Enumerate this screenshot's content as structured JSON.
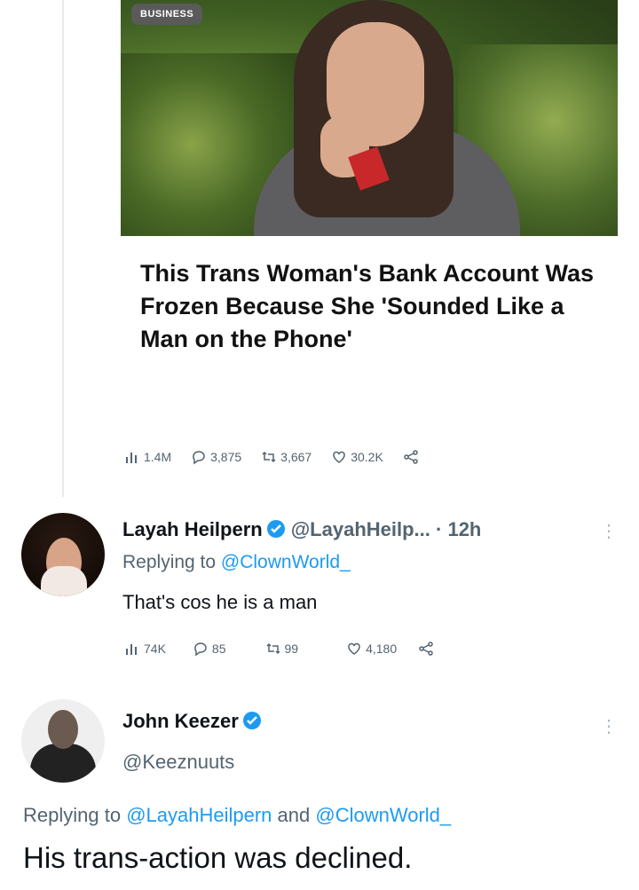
{
  "article": {
    "badge": "BUSINESS",
    "headline": "This Trans Woman's Bank Account Was Frozen Because She 'Sounded Like a Man on the Phone'",
    "metrics": {
      "views": "1.4M",
      "replies": "3,875",
      "retweets": "3,667",
      "likes": "30.2K"
    }
  },
  "reply1": {
    "name": "Layah Heilpern",
    "handle": "@LayahHeilp...",
    "time": "· 12h",
    "replying_prefix": "Replying to",
    "replying_to": "@ClownWorld_",
    "text": "That's cos he is a man",
    "metrics": {
      "views": "74K",
      "replies": "85",
      "retweets": "99",
      "likes": "4,180"
    }
  },
  "reply2": {
    "name": "John Keezer",
    "handle": "@Keeznuuts",
    "replying_prefix": "Replying to",
    "replying_to_1": "@LayahHeilpern",
    "replying_and": "and",
    "replying_to_2": "@ClownWorld_",
    "text": "His trans-action was declined."
  },
  "icons": {
    "views": "bar-chart-icon",
    "reply": "speech-bubble-icon",
    "retweet": "retweet-icon",
    "like": "heart-icon",
    "share": "share-icon",
    "verified": "verified-badge-icon"
  },
  "colors": {
    "link": "#1d9bf0",
    "muted": "#536471",
    "verified": "#1d9bf0"
  }
}
